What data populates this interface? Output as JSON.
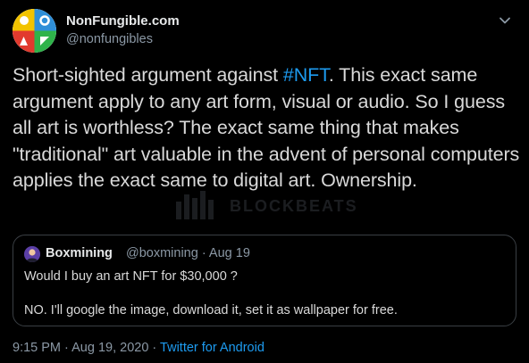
{
  "author": {
    "display_name": "NonFungible.com",
    "handle": "@nonfungibles",
    "avatar_icon": "nonfungible-logo-icon",
    "menu_icon": "chevron-down-icon"
  },
  "tweet": {
    "text_before": "Short-sighted argument against ",
    "hashtag": "#NFT",
    "text_after": ". This exact same argument apply to any art form, visual or audio. So I guess all art is worthless? The exact same thing that makes \"traditional\" art valuable in the advent of personal computers applies the exact same to digital art. Ownership."
  },
  "watermark": {
    "text": "BLOCKBEATS"
  },
  "quoted_tweet": {
    "display_name": "Boxmining",
    "handle": "@boxmining",
    "separator": "·",
    "date": "Aug 19",
    "line1": "Would I buy an art NFT for $30,000 ?",
    "line2": "NO. I'll google the image, download it, set it as wallpaper for free."
  },
  "footer": {
    "time": "9:15 PM",
    "separator": "·",
    "date": "Aug 19, 2020",
    "source": "Twitter for Android"
  },
  "colors": {
    "background": "#000000",
    "link_blue": "#1d9bf0",
    "secondary_text": "#8b98a5",
    "border": "#3a3f44"
  }
}
